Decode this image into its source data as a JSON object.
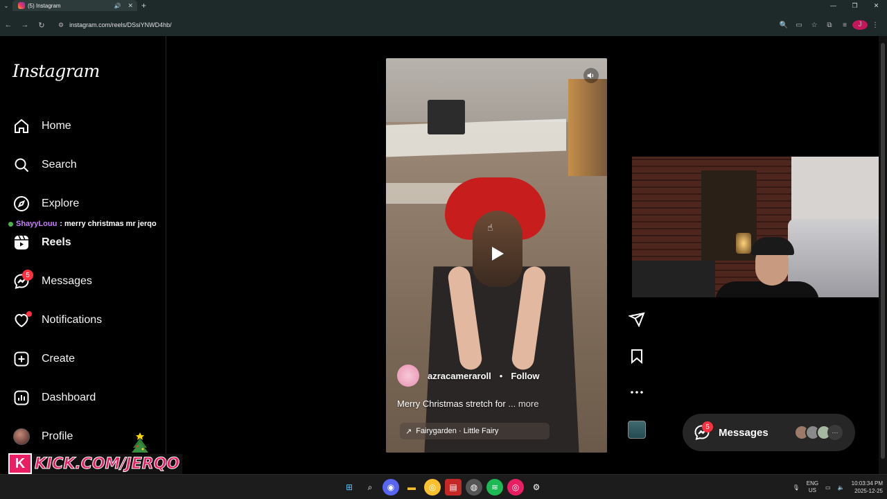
{
  "browser": {
    "tab_title": "(5) Instagram",
    "new_tab_symbol": "+",
    "url": "instagram.com/reels/DSsiYNWD4hb/"
  },
  "sidebar": {
    "logo": "Instagram",
    "items": [
      {
        "label": "Home",
        "icon": "home-icon"
      },
      {
        "label": "Search",
        "icon": "search-icon"
      },
      {
        "label": "Explore",
        "icon": "compass-icon"
      },
      {
        "label": "Reels",
        "icon": "reels-icon"
      },
      {
        "label": "Messages",
        "icon": "messenger-icon",
        "badge": "5"
      },
      {
        "label": "Notifications",
        "icon": "heart-icon"
      },
      {
        "label": "Create",
        "icon": "plus-square-icon"
      },
      {
        "label": "Dashboard",
        "icon": "chart-icon"
      },
      {
        "label": "Profile",
        "icon": "avatar-icon"
      }
    ]
  },
  "stream_overlay": {
    "chat_user": "ShayyLouu",
    "chat_message": ": merry christmas mr jerqo",
    "banner_letter": "K",
    "banner_text": "KICK.COM/JERQO"
  },
  "reel": {
    "author": "azracameraroll",
    "separator": "•",
    "follow_label": "Follow",
    "caption": "Merry Christmas stretch for",
    "more_label": "... more",
    "audio": "Fairygarden · Little Fairy"
  },
  "messages_pill": {
    "label": "Messages",
    "badge": "5",
    "more": "···"
  },
  "taskbar": {
    "lang_top": "ENG",
    "lang_bottom": "US",
    "time": "10:03:34 PM",
    "date": "2025-12-25"
  },
  "colors": {
    "accent_badge": "#ff3040",
    "kick_pink": "#e91e63",
    "chat_user": "#c77dff"
  }
}
